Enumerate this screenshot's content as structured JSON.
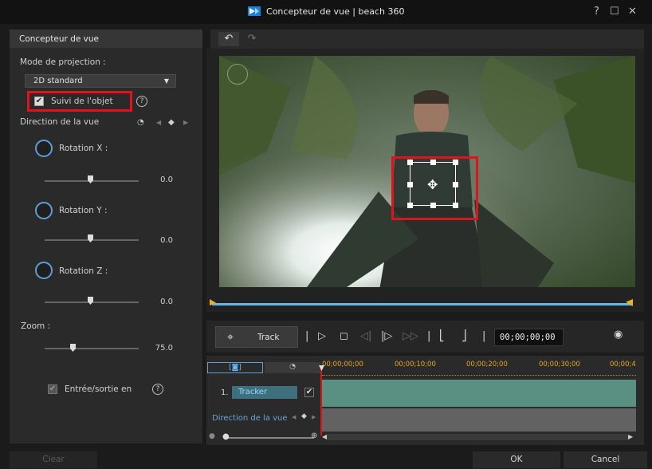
{
  "window": {
    "title": "Concepteur de vue  |  beach 360",
    "help_glyph": "?",
    "maximize_glyph": "☐",
    "close_glyph": "✕"
  },
  "left_panel": {
    "header": "Concepteur de vue",
    "projection_label": "Mode de projection :",
    "projection_value": "2D standard",
    "follow_object_label": "Suivi de l'objet",
    "follow_object_checked": true,
    "view_direction_label": "Direction de la vue",
    "rotation_x_label": "Rotation X :",
    "rotation_x_value": "0.0",
    "rotation_y_label": "Rotation Y :",
    "rotation_y_value": "0.0",
    "rotation_z_label": "Rotation Z :",
    "rotation_z_value": "0.0",
    "zoom_label": "Zoom :",
    "zoom_value": "75.0",
    "entry_exit_label": "Entrée/sortie en",
    "entry_exit_checked": true
  },
  "toolbar": {
    "undo_glyph": "↶",
    "redo_glyph": "↷"
  },
  "transport": {
    "track_label": "Track",
    "timecode": "00;00;00;00"
  },
  "timeline": {
    "ruler": [
      "00;00;00;00",
      "00;00;10;00",
      "00;00;20;00",
      "00;00;30;00",
      "00;00;4"
    ],
    "tracker_index": "1.",
    "tracker_label": "Tracker",
    "direction_label": "Direction de la vue"
  },
  "buttons": {
    "clear": "Clear",
    "ok": "OK",
    "cancel": "Cancel"
  },
  "colors": {
    "accent_blue": "#65b8e6",
    "highlight_red": "#e0121b",
    "track_teal": "#5a9081",
    "marker_orange": "#e7b12a"
  }
}
